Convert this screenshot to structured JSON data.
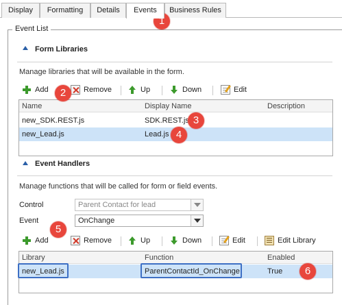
{
  "tabs": [
    {
      "label": "Display"
    },
    {
      "label": "Formatting"
    },
    {
      "label": "Details"
    },
    {
      "label": "Events"
    },
    {
      "label": "Business Rules"
    }
  ],
  "active_tab": "Events",
  "event_list_label": "Event List",
  "form_libraries": {
    "title": "Form Libraries",
    "description": "Manage libraries that will be available in the form.",
    "toolbar": {
      "add": "Add",
      "remove": "Remove",
      "up": "Up",
      "down": "Down",
      "edit": "Edit"
    },
    "columns": [
      "Name",
      "Display Name",
      "Description"
    ],
    "rows": [
      {
        "name": "new_SDK.REST.js",
        "display_name": "SDK.REST.js",
        "description": ""
      },
      {
        "name": "new_Lead.js",
        "display_name": "Lead.js",
        "description": ""
      }
    ],
    "selected_row": 1
  },
  "event_handlers": {
    "title": "Event Handlers",
    "description": "Manage functions that will be called for form or field events.",
    "control_label": "Control",
    "control_value": "Parent Contact for lead",
    "event_label": "Event",
    "event_value": "OnChange",
    "toolbar": {
      "add": "Add",
      "remove": "Remove",
      "up": "Up",
      "down": "Down",
      "edit": "Edit",
      "edit_library": "Edit Library"
    },
    "columns": [
      "Library",
      "Function",
      "Enabled"
    ],
    "rows": [
      {
        "library": "new_Lead.js",
        "function": "ParentContactId_OnChange",
        "enabled": "True"
      }
    ]
  },
  "callouts": [
    "1",
    "2",
    "3",
    "4",
    "5",
    "6"
  ],
  "colors": {
    "callout": "#e8463c",
    "highlight": "#3d6fc4",
    "selected_row": "#cde3f8",
    "section_arrow": "#2a5fa7"
  }
}
